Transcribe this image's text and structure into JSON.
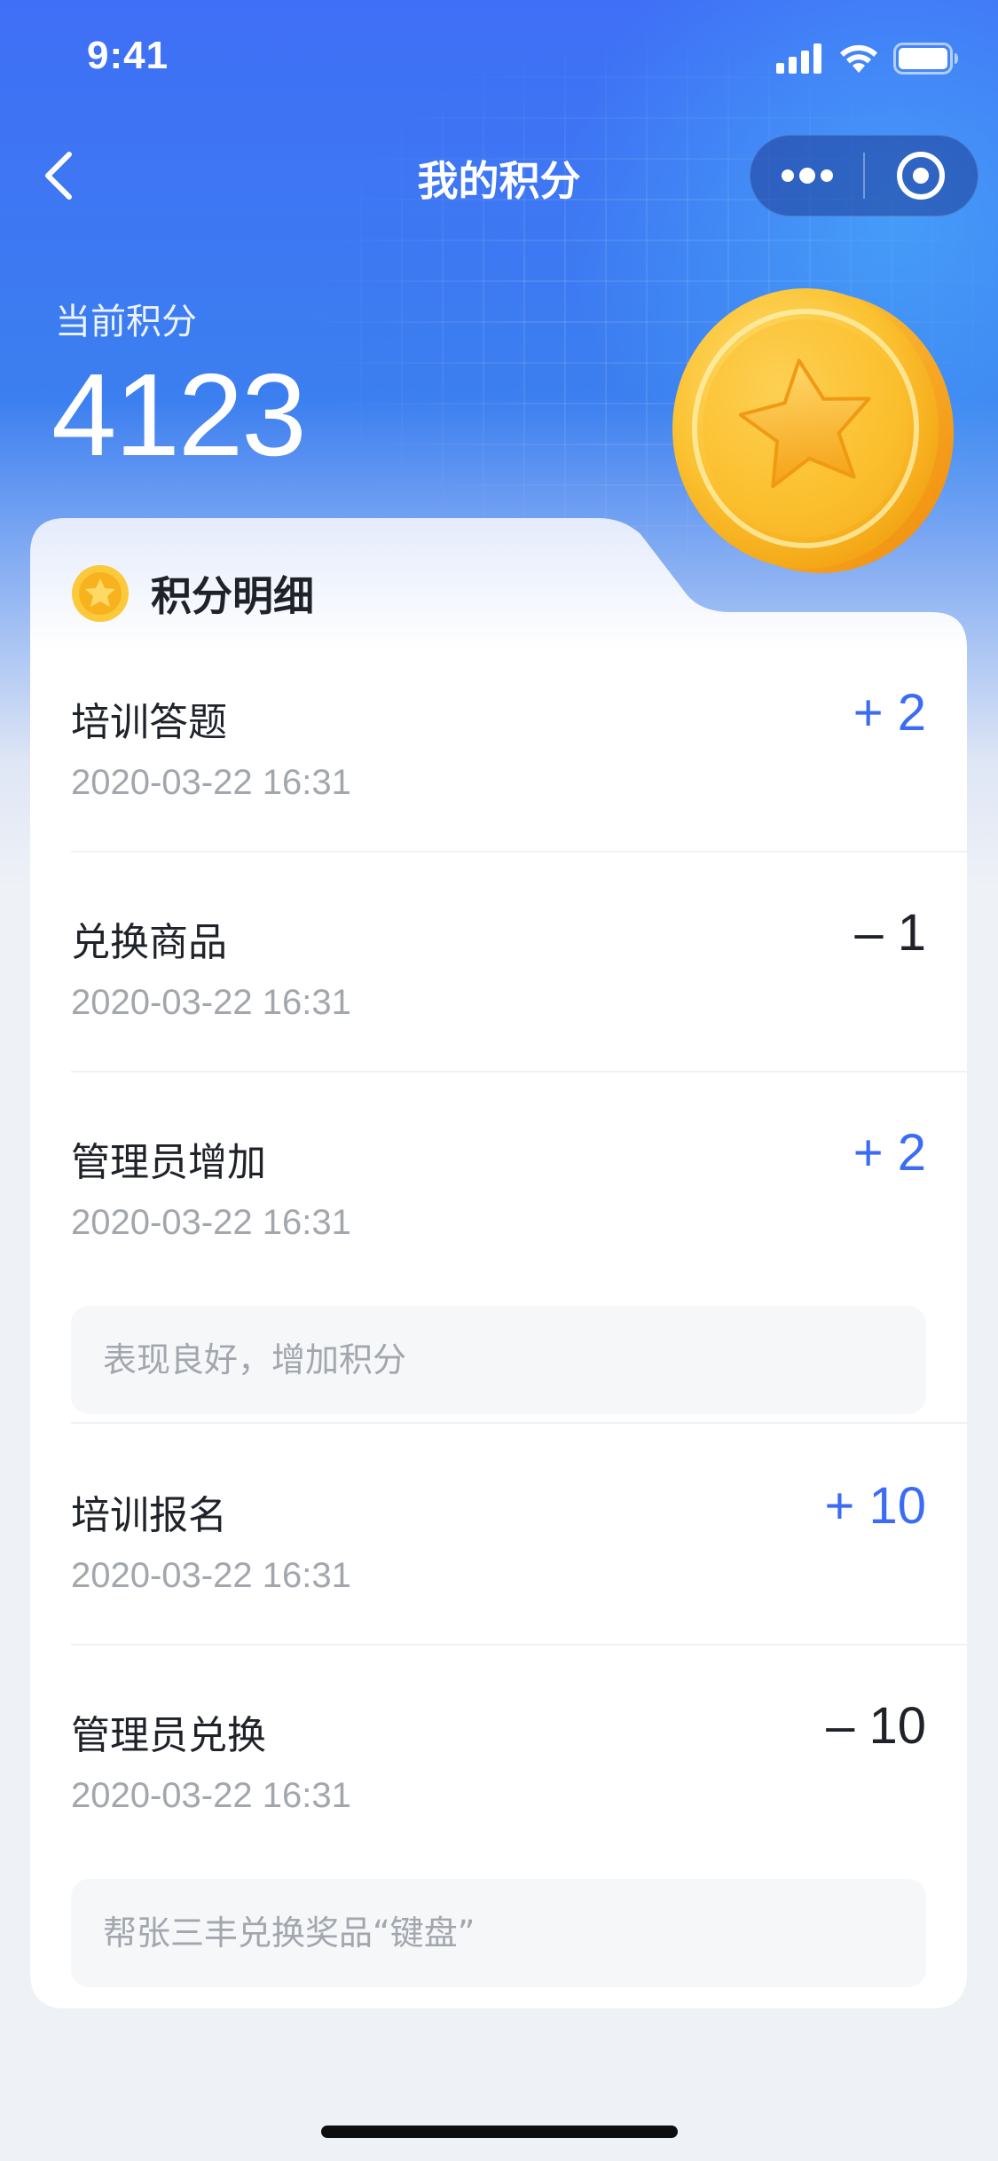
{
  "status_bar": {
    "time": "9:41"
  },
  "nav": {
    "title": "我的积分"
  },
  "points": {
    "label": "当前积分",
    "value": "4123"
  },
  "card": {
    "title": "积分明细"
  },
  "records": [
    {
      "name": "培训答题",
      "time": "2020-03-22 16:31",
      "delta": "+ 2",
      "sign": "plus"
    },
    {
      "name": "兑换商品",
      "time": "2020-03-22 16:31",
      "delta": "– 1",
      "sign": "minus"
    },
    {
      "name": "管理员增加",
      "time": "2020-03-22 16:31",
      "delta": "+ 2",
      "sign": "plus",
      "note": "表现良好，增加积分"
    },
    {
      "name": "培训报名",
      "time": "2020-03-22 16:31",
      "delta": "+ 10",
      "sign": "plus"
    },
    {
      "name": "管理员兑换",
      "time": "2020-03-22 16:31",
      "delta": "– 10",
      "sign": "minus",
      "note": "帮张三丰兑换奖品“键盘”"
    }
  ],
  "colors": {
    "accent_blue": "#3b6cf3",
    "header_blue": "#3f6ff6",
    "coin_gold": "#f7b21e"
  },
  "icons": {
    "back": "chevron-left-icon",
    "more": "more-dots-icon",
    "close": "target-circle-icon",
    "signal": "cellular-signal-icon",
    "wifi": "wifi-icon",
    "battery": "battery-icon",
    "coin": "star-coin-icon"
  }
}
